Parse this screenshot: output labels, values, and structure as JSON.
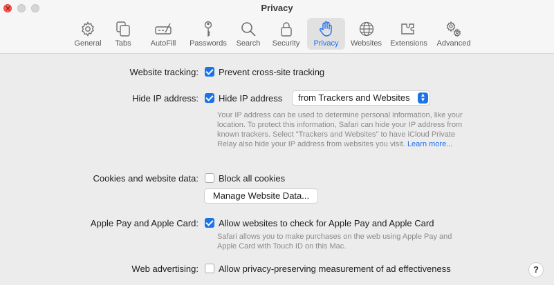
{
  "window": {
    "title": "Privacy"
  },
  "toolbar": {
    "tabs": [
      {
        "label": "General",
        "icon": "gear-icon"
      },
      {
        "label": "Tabs",
        "icon": "tabs-icon"
      },
      {
        "label": "AutoFill",
        "icon": "autofill-icon"
      },
      {
        "label": "Passwords",
        "icon": "key-icon"
      },
      {
        "label": "Search",
        "icon": "search-icon"
      },
      {
        "label": "Security",
        "icon": "lock-icon"
      },
      {
        "label": "Privacy",
        "icon": "hand-icon",
        "active": true
      },
      {
        "label": "Websites",
        "icon": "globe-icon"
      },
      {
        "label": "Extensions",
        "icon": "extensions-icon"
      },
      {
        "label": "Advanced",
        "icon": "gears-icon"
      }
    ]
  },
  "settings": {
    "tracking": {
      "label": "Website tracking:",
      "checkbox": "Prevent cross-site tracking",
      "checked": true
    },
    "hide_ip": {
      "label": "Hide IP address:",
      "checkbox": "Hide IP address",
      "checked": true,
      "select_value": "from Trackers and Websites",
      "help": "Your IP address can be used to determine personal information, like your location. To protect this information, Safari can hide your IP address from known trackers. Select \"Trackers and Websites\" to have iCloud Private Relay also hide your IP address from websites you visit.",
      "learn_more": "Learn more..."
    },
    "cookies": {
      "label": "Cookies and website data:",
      "checkbox": "Block all cookies",
      "checked": false,
      "button": "Manage Website Data..."
    },
    "apple_pay": {
      "label": "Apple Pay and Apple Card:",
      "checkbox": "Allow websites to check for Apple Pay and Apple Card",
      "checked": true,
      "help": "Safari allows you to make purchases on the web using Apple Pay and Apple Card with Touch ID on this Mac."
    },
    "advertising": {
      "label": "Web advertising:",
      "checkbox": "Allow privacy-preserving measurement of ad effectiveness",
      "checked": false
    }
  },
  "help_button": "?",
  "colors": {
    "accent": "#1a73e8",
    "close": "#ff5f57"
  }
}
